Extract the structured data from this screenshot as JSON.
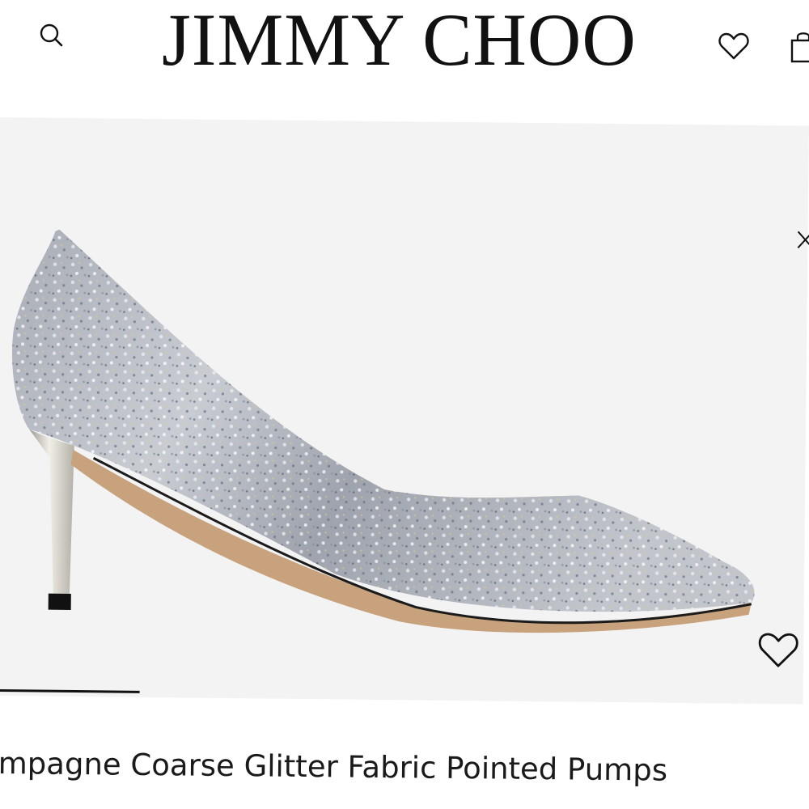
{
  "header": {
    "logo": "JIMMY CHOO",
    "search_icon": "search-icon",
    "wishlist_icon": "heart-icon",
    "bag_icon": "shopping-bag-icon"
  },
  "gallery": {
    "close_icon": "close-icon",
    "wishlist_icon": "heart-icon",
    "progress": 0.18
  },
  "product": {
    "name": "mpagne Coarse Glitter Fabric Pointed Pumps"
  },
  "colors": {
    "text": "#111111",
    "gallery_bg": "#f3f3f4",
    "glitter": "#b9bcc4",
    "lining": "#e8d9a8",
    "heel": "#d8d6cc"
  }
}
